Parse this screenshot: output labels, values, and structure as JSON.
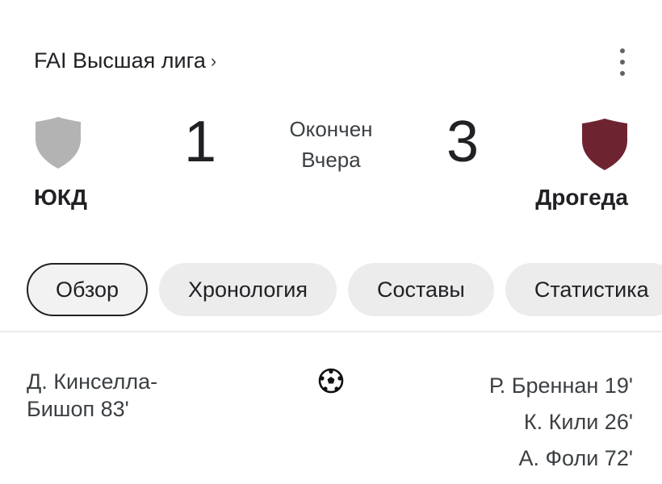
{
  "header": {
    "league": "FAI Высшая лига",
    "chevron": "›",
    "menu_icon": "more-vert-icon"
  },
  "match": {
    "status": "Окончен",
    "date": "Вчера",
    "home": {
      "name": "ЮКД",
      "score": "1",
      "crest_color": "#b3b3b3"
    },
    "away": {
      "name": "Дрогеда",
      "score": "3",
      "crest_color": "#6e2430"
    }
  },
  "tabs": [
    {
      "label": "Обзор",
      "active": true
    },
    {
      "label": "Хронология",
      "active": false
    },
    {
      "label": "Составы",
      "active": false
    },
    {
      "label": "Статистика",
      "active": false
    }
  ],
  "goals": {
    "icon": "soccer-ball-icon",
    "home": [
      "Д. Кинселла-Бишоп 83'"
    ],
    "away": [
      "Р. Бреннан 19'",
      "К. Кили 26'",
      "А. Фоли 72'"
    ]
  }
}
